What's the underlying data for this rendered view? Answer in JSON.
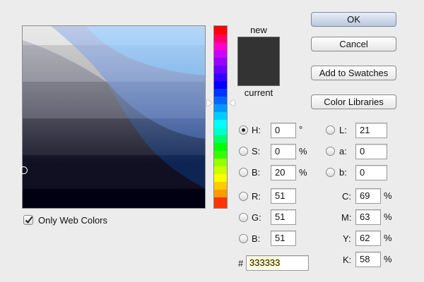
{
  "field": {
    "bands": [
      "#000000",
      "#000033",
      "#000066",
      "#003366",
      "#336699",
      "#6699cc",
      "#99ccff",
      "#ccffff"
    ],
    "cursor_color": "#333333"
  },
  "swatch": {
    "new_label": "new",
    "current_label": "current",
    "new_color": "#333333"
  },
  "buttons": {
    "ok": "OK",
    "cancel": "Cancel",
    "add_swatches": "Add to Swatches",
    "color_libraries": "Color Libraries"
  },
  "hsb": {
    "h_label": "H:",
    "h_value": "0",
    "h_unit": "°",
    "s_label": "S:",
    "s_value": "0",
    "s_unit": "%",
    "b_label": "B:",
    "b_value": "20",
    "b_unit": "%",
    "selected": "H"
  },
  "lab": {
    "l_label": "L:",
    "l_value": "21",
    "a_label": "a:",
    "a_value": "0",
    "b_label": "b:",
    "b_value": "0"
  },
  "rgb": {
    "r_label": "R:",
    "r_value": "51",
    "g_label": "G:",
    "g_value": "51",
    "b_label": "B:",
    "b_value": "51"
  },
  "cmyk": {
    "c_label": "C:",
    "c_value": "69",
    "c_unit": "%",
    "m_label": "M:",
    "m_value": "63",
    "m_unit": "%",
    "y_label": "Y:",
    "y_value": "62",
    "y_unit": "%",
    "k_label": "K:",
    "k_value": "58",
    "k_unit": "%"
  },
  "hex": {
    "label": "#",
    "value": "333333",
    "highlight": "#fffbc4"
  },
  "web_colors": {
    "label": "Only Web Colors",
    "checked": true
  }
}
